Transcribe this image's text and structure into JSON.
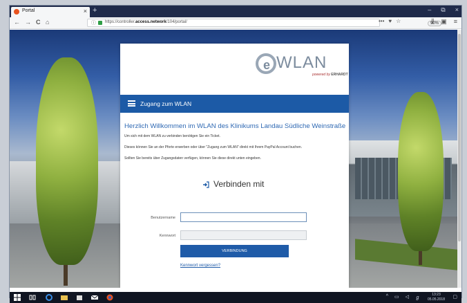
{
  "browser": {
    "tab_title": "Portal",
    "tab_close": "×",
    "new_tab": "+",
    "win_minimize": "–",
    "win_restore": "⧉",
    "win_close": "×",
    "nav_back": "←",
    "nav_forward": "→",
    "nav_reload": "C",
    "nav_home": "⌂",
    "url_info": "ⓘ",
    "url_prefix": "https://controller.",
    "url_domain": "access.network",
    "url_path": "/104/portal/",
    "zoom": "90%",
    "url_more": "•••",
    "url_pocket": "♥",
    "url_star": "☆",
    "tool_library": "⫼",
    "tool_sidebar": "▣",
    "tool_menu": "≡"
  },
  "portal": {
    "logo_e": "e",
    "logo_wlan": "WLAN",
    "logo_powered": "powered by",
    "logo_brand": "ERHARDT",
    "menu_label": "Zugang zum WLAN",
    "welcome": "Herzlich Willkommen im WLAN des Klinikums Landau Südliche Weinstraße",
    "paragraphs": [
      "Um sich mit dem WLAN zu verbinden benötigen Sie ein Ticket.",
      "Dieses können Sie an der Pforte erwerben oder über \"Zugang zum WLAN\" direkt mit Ihrem PayPal Account buchen.",
      "Sollten Sie bereits über Zugangsdaten verfügen, können Sie diese direkt unten eingeben."
    ],
    "connect_label": "Verbinden mit",
    "username_label": "Benutzername",
    "password_label": "Kennwort",
    "username_value": "",
    "password_value": "",
    "submit_label": "VERBINDUNG",
    "forgot_label": "Kennwort vergessen?"
  },
  "taskbar": {
    "clock_time": "13:23",
    "clock_date": "05.05.2018"
  },
  "colors": {
    "accent": "#1c5aa6",
    "link": "#2f69b3",
    "firefox": "#e8531f"
  }
}
